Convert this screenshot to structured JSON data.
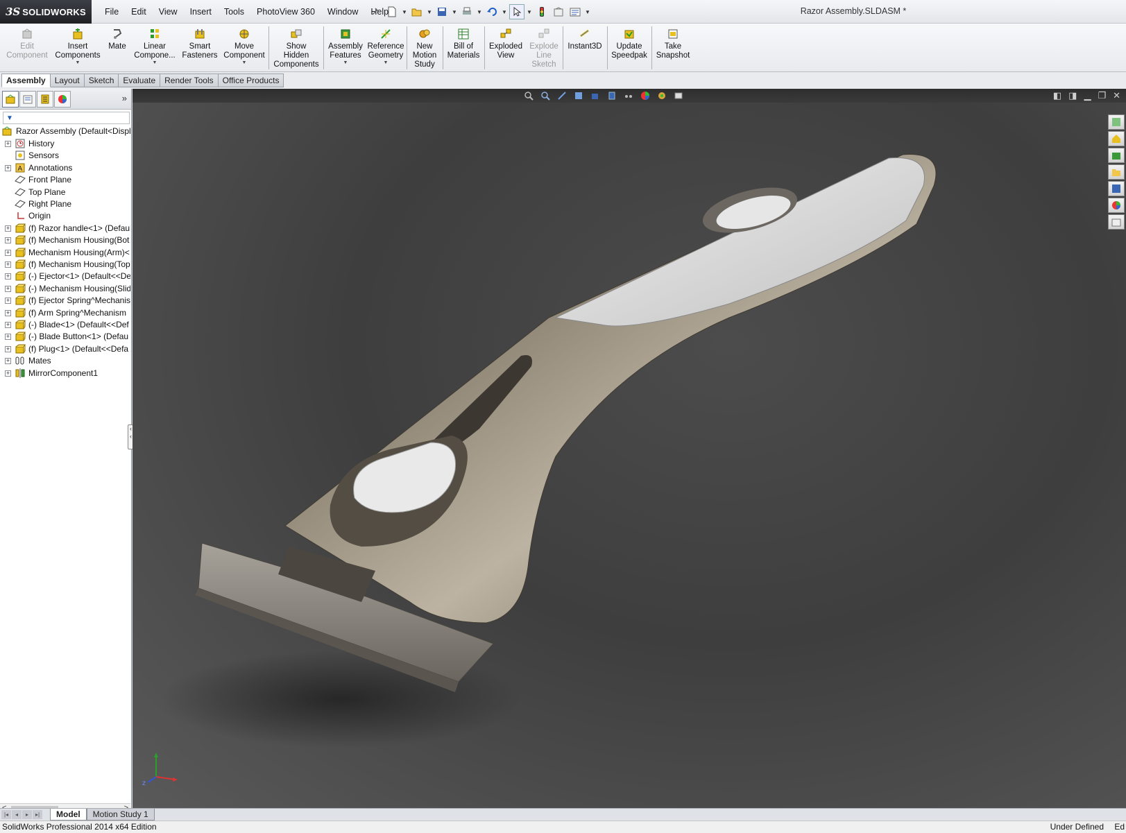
{
  "app": {
    "brand": "SOLIDWORKS",
    "brand_prefix": "3S",
    "document_title": "Razor Assembly.SLDASM *"
  },
  "menu": [
    "File",
    "Edit",
    "View",
    "Insert",
    "Tools",
    "PhotoView 360",
    "Window",
    "Help"
  ],
  "ribbon": {
    "edit_component": [
      "Edit",
      "Component"
    ],
    "insert_components": [
      "Insert",
      "Components"
    ],
    "mate": [
      "Mate"
    ],
    "linear_component": [
      "Linear",
      "Compone..."
    ],
    "smart_fasteners": [
      "Smart",
      "Fasteners"
    ],
    "move_component": [
      "Move",
      "Component"
    ],
    "show_hidden": [
      "Show",
      "Hidden",
      "Components"
    ],
    "assembly_features": [
      "Assembly",
      "Features"
    ],
    "reference_geometry": [
      "Reference",
      "Geometry"
    ],
    "new_motion_study": [
      "New",
      "Motion",
      "Study"
    ],
    "bill_of_materials": [
      "Bill of",
      "Materials"
    ],
    "exploded_view": [
      "Exploded",
      "View"
    ],
    "explode_line_sketch": [
      "Explode",
      "Line",
      "Sketch"
    ],
    "instant3d": [
      "Instant3D"
    ],
    "update_speedpak": [
      "Update",
      "Speedpak"
    ],
    "take_snapshot": [
      "Take",
      "Snapshot"
    ]
  },
  "tabs": [
    {
      "label": "Assembly",
      "active": true
    },
    {
      "label": "Layout",
      "active": false
    },
    {
      "label": "Sketch",
      "active": false
    },
    {
      "label": "Evaluate",
      "active": false
    },
    {
      "label": "Render Tools",
      "active": false
    },
    {
      "label": "Office Products",
      "active": false
    }
  ],
  "tree": {
    "root": "Razor Assembly  (Default<Displ",
    "items": [
      {
        "label": "History",
        "icon": "history-icon",
        "expandable": true
      },
      {
        "label": "Sensors",
        "icon": "sensors-icon",
        "expandable": false
      },
      {
        "label": "Annotations",
        "icon": "annotations-icon",
        "expandable": true
      },
      {
        "label": "Front Plane",
        "icon": "plane-icon",
        "expandable": false
      },
      {
        "label": "Top Plane",
        "icon": "plane-icon",
        "expandable": false
      },
      {
        "label": "Right Plane",
        "icon": "plane-icon",
        "expandable": false
      },
      {
        "label": "Origin",
        "icon": "origin-icon",
        "expandable": false
      },
      {
        "label": "(f) Razor handle<1> (Defaul",
        "icon": "part-icon",
        "expandable": true
      },
      {
        "label": "(f) Mechanism Housing(Bot",
        "icon": "part-icon",
        "expandable": true
      },
      {
        "label": "Mechanism Housing(Arm)<",
        "icon": "part-icon",
        "expandable": true
      },
      {
        "label": "(f) Mechanism Housing(Top",
        "icon": "part-icon",
        "expandable": true
      },
      {
        "label": "(-) Ejector<1> (Default<<De",
        "icon": "part-icon",
        "expandable": true
      },
      {
        "label": "(-) Mechanism Housing(Slid",
        "icon": "part-icon",
        "expandable": true
      },
      {
        "label": "(f) Ejector Spring^Mechanis",
        "icon": "part-icon",
        "expandable": true
      },
      {
        "label": "(f) Arm Spring^Mechanism",
        "icon": "part-icon",
        "expandable": true
      },
      {
        "label": "(-) Blade<1> (Default<<Def",
        "icon": "part-icon",
        "expandable": true
      },
      {
        "label": "(-) Blade Button<1> (Defau",
        "icon": "part-icon",
        "expandable": true
      },
      {
        "label": "(f) Plug<1> (Default<<Defa",
        "icon": "part-icon",
        "expandable": true
      },
      {
        "label": "Mates",
        "icon": "mates-icon",
        "expandable": true
      },
      {
        "label": "MirrorComponent1",
        "icon": "mirror-icon",
        "expandable": true
      }
    ]
  },
  "bottom_tabs": [
    {
      "label": "Model",
      "active": true
    },
    {
      "label": "Motion Study 1",
      "active": false
    }
  ],
  "status": {
    "left": "SolidWorks Professional 2014 x64 Edition",
    "right": "Under Defined",
    "edit": "Ed"
  },
  "colors": {
    "accent": "#1f5bb5",
    "part_yellow": "#e8c020",
    "viewport_bg": "#454545"
  }
}
